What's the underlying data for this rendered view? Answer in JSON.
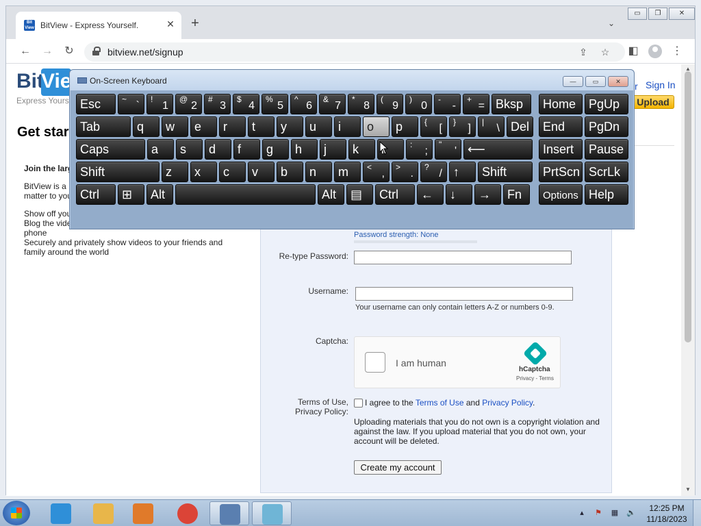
{
  "browser": {
    "tab_title": "BitView - Express Yourself.",
    "tab_favicon_text": "Bit View",
    "tab_close": "✕",
    "new_tab": "+",
    "tab_search_icon": "⌄",
    "url": "bitview.net/signup",
    "window_buttons": [
      "▭",
      "❐",
      "✕"
    ]
  },
  "site": {
    "logo_bit": "Bit",
    "logo_view": "View",
    "tagline": "Express Yourse",
    "page_title": "Get star",
    "link_right_fragment": "r",
    "sign_in": "Sign In",
    "upload": "Upload"
  },
  "left_col": {
    "heading": "Join the larg",
    "para1": "BitView is a",
    "para1_b": "matter to you",
    "para2_a": "Show off you",
    "para2_b": "Blog the vide",
    "para2_c": "phone",
    "para2_d": "Securely and privately show videos to your friends and",
    "para2_e": "family around the world"
  },
  "form": {
    "strength_label": "Password strength: None",
    "retype_label": "Re-type Password:",
    "retype_value": "",
    "username_label": "Username:",
    "username_value": "",
    "username_hint": "Your username can only contain letters A-Z or numbers 0-9.",
    "captcha_label": "Captcha:",
    "captcha_text": "I am human",
    "captcha_brand": "hCaptcha",
    "captcha_links": "Privacy - Terms",
    "tos_label_1": "Terms of Use,",
    "tos_label_2": "Privacy Policy:",
    "tos_pre": "I agree to the ",
    "tos_link": "Terms of Use",
    "tos_and": " and ",
    "privacy_link": "Privacy Policy",
    "tos_end": ".",
    "warning": "Uploading materials that you do not own is a copyright violation and against the law. If you upload material that you do not own, your account will be deleted.",
    "create_button": "Create my account"
  },
  "osk": {
    "title": "On-Screen Keyboard",
    "controls": [
      "—",
      "▭",
      "✕"
    ],
    "rows": [
      [
        {
          "main": "Esc"
        },
        {
          "upper": "~",
          "lower": "`"
        },
        {
          "upper": "!",
          "lower": "1"
        },
        {
          "upper": "@",
          "lower": "2"
        },
        {
          "upper": "#",
          "lower": "3"
        },
        {
          "upper": "$",
          "lower": "4"
        },
        {
          "upper": "%",
          "lower": "5"
        },
        {
          "upper": "^",
          "lower": "6"
        },
        {
          "upper": "&",
          "lower": "7"
        },
        {
          "upper": "*",
          "lower": "8"
        },
        {
          "upper": "(",
          "lower": "9"
        },
        {
          "upper": ")",
          "lower": "0"
        },
        {
          "upper": "-",
          "lower": "-"
        },
        {
          "upper": "+",
          "lower": "="
        },
        {
          "main": "Bksp"
        },
        {
          "main": "Home"
        },
        {
          "main": "PgUp"
        }
      ],
      [
        {
          "main": "Tab"
        },
        {
          "main": "q"
        },
        {
          "main": "w"
        },
        {
          "main": "e"
        },
        {
          "main": "r"
        },
        {
          "main": "t"
        },
        {
          "main": "y"
        },
        {
          "main": "u"
        },
        {
          "main": "i"
        },
        {
          "main": "o",
          "pressed": true
        },
        {
          "main": "p"
        },
        {
          "upper": "{",
          "lower": "["
        },
        {
          "upper": "}",
          "lower": "]"
        },
        {
          "upper": "|",
          "lower": "\\"
        },
        {
          "main": "Del"
        },
        {
          "main": "End"
        },
        {
          "main": "PgDn"
        }
      ],
      [
        {
          "main": "Caps"
        },
        {
          "main": "a"
        },
        {
          "main": "s"
        },
        {
          "main": "d"
        },
        {
          "main": "f"
        },
        {
          "main": "g"
        },
        {
          "main": "h"
        },
        {
          "main": "j"
        },
        {
          "main": "k"
        },
        {
          "main": "l"
        },
        {
          "upper": ":",
          "lower": ";"
        },
        {
          "upper": "\"",
          "lower": "'"
        },
        {
          "main": "⟵"
        },
        {
          "main": "Insert"
        },
        {
          "main": "Pause"
        }
      ],
      [
        {
          "main": "Shift"
        },
        {
          "main": "z"
        },
        {
          "main": "x"
        },
        {
          "main": "c"
        },
        {
          "main": "v"
        },
        {
          "main": "b"
        },
        {
          "main": "n"
        },
        {
          "main": "m"
        },
        {
          "upper": "<",
          "lower": ","
        },
        {
          "upper": ">",
          "lower": "."
        },
        {
          "upper": "?",
          "lower": "/"
        },
        {
          "main": "↑"
        },
        {
          "main": "Shift"
        },
        {
          "main": "PrtScn"
        },
        {
          "main": "ScrLk"
        }
      ],
      [
        {
          "main": "Ctrl"
        },
        {
          "main": "⊞"
        },
        {
          "main": "Alt"
        },
        {
          "main": ""
        },
        {
          "main": "Alt"
        },
        {
          "main": "▤"
        },
        {
          "main": "Ctrl"
        },
        {
          "main": "←"
        },
        {
          "main": "↓"
        },
        {
          "main": "→"
        },
        {
          "main": "Fn"
        },
        {
          "main": "Options",
          "small": true
        },
        {
          "main": "Help"
        }
      ]
    ]
  },
  "taskbar": {
    "items": [
      {
        "name": "internet-explorer",
        "color": "#2f8fd8"
      },
      {
        "name": "file-explorer",
        "color": "#e8b64a"
      },
      {
        "name": "media-player",
        "color": "#e07a2a"
      },
      {
        "name": "chrome",
        "color": "#db4437"
      },
      {
        "name": "on-screen-keyboard",
        "color": "#5a7fb0"
      },
      {
        "name": "notepad",
        "color": "#6fb5d6"
      }
    ],
    "tray_icons": [
      "▴",
      "⚑",
      "▦",
      "🔈"
    ],
    "time": "12:25 PM",
    "date": "11/18/2023"
  }
}
